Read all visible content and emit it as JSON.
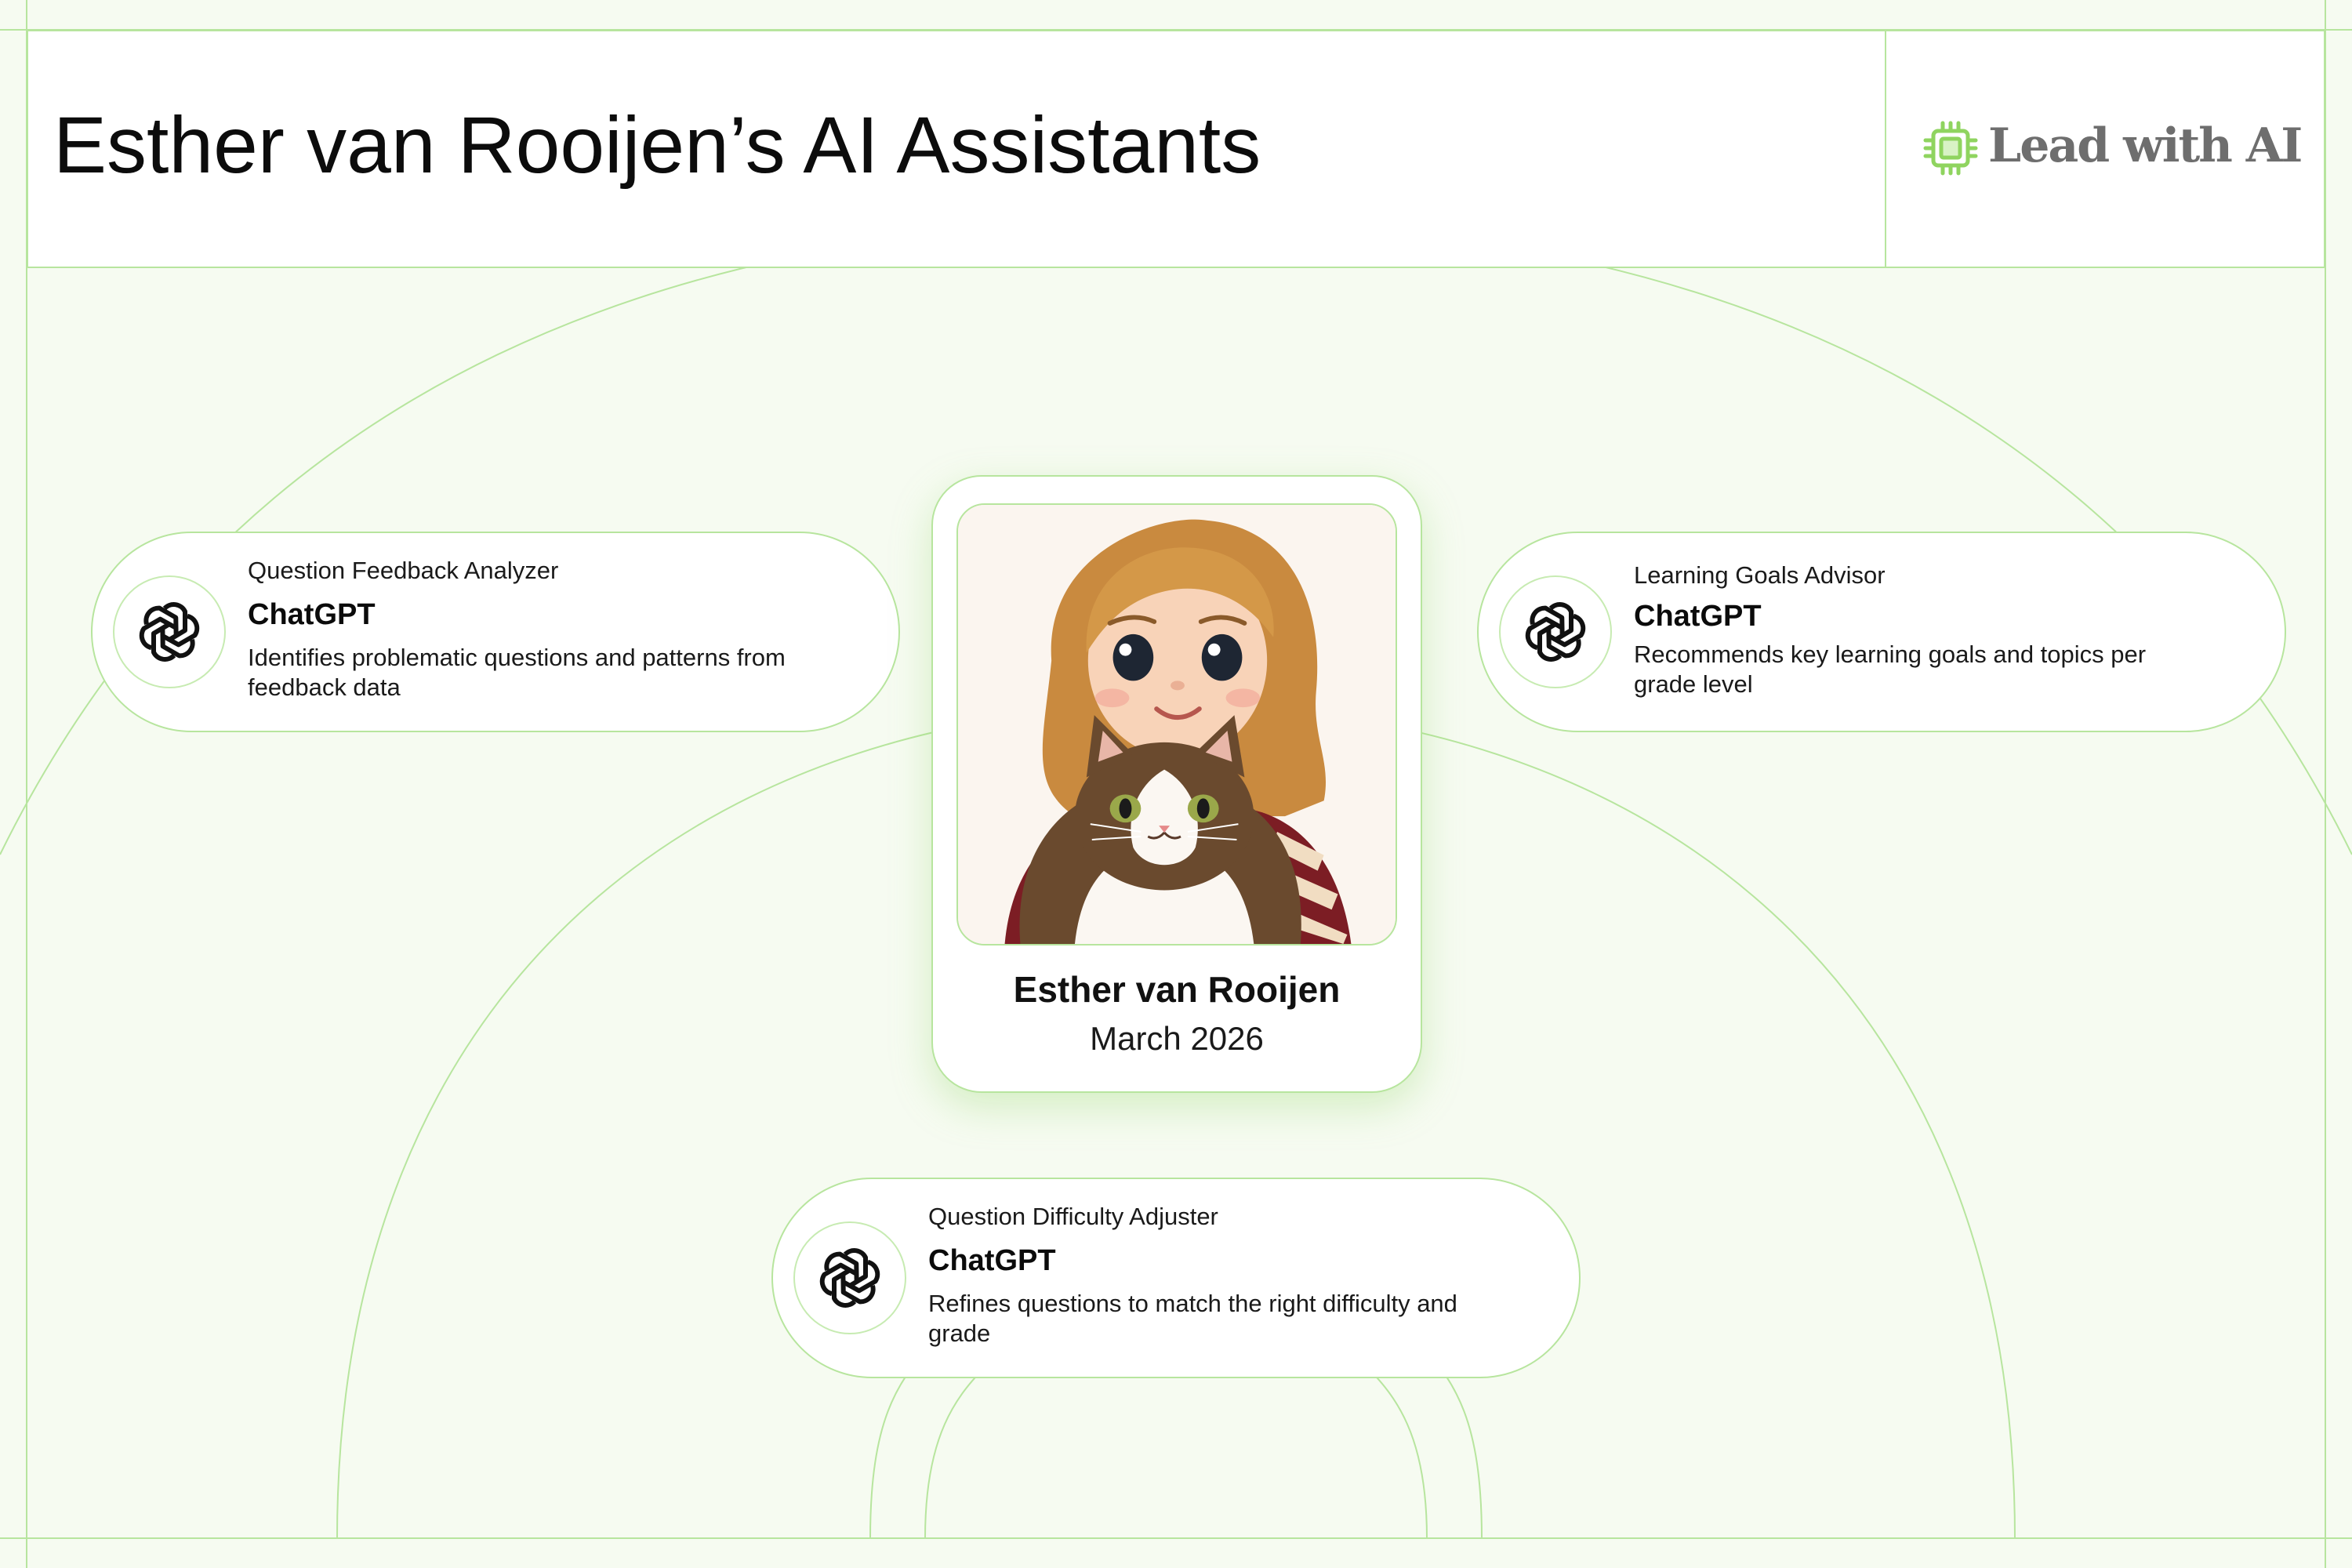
{
  "header": {
    "title": "Esther van Rooijen’s AI Assistants",
    "logo_text": "Lead with AI",
    "logo_icon": "chip-icon"
  },
  "profile": {
    "name": "Esther van Rooijen",
    "date": "March 2026",
    "avatar": "cartoon woman holding a cat"
  },
  "assistants": [
    {
      "title": "Question Feedback Analyzer",
      "tool": "ChatGPT",
      "description": "Identifies problematic questions and patterns from feedback data",
      "icon": "openai-icon"
    },
    {
      "title": "Learning Goals Advisor",
      "tool": "ChatGPT",
      "description": "Recommends key learning goals and topics per grade level",
      "icon": "openai-icon"
    },
    {
      "title": "Question Difficulty Adjuster",
      "tool": "ChatGPT",
      "description": "Refines questions to match the right difficulty and grade",
      "icon": "openai-icon"
    }
  ],
  "colors": {
    "background": "#f6fbf1",
    "accent_line": "#b7e59e",
    "logo_green": "#8fd45f",
    "logo_text": "#6e6e6e"
  }
}
